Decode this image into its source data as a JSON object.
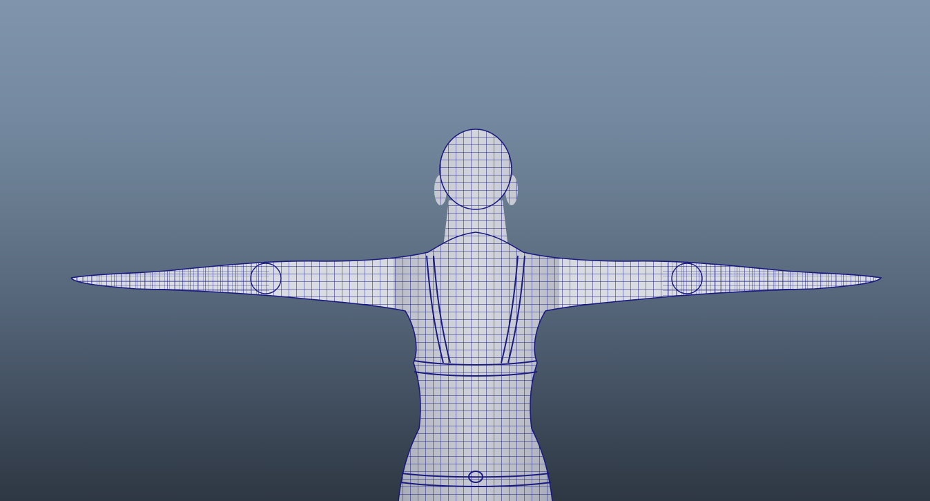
{
  "viewport": {
    "background_top": "#8095ac",
    "background_bottom": "#2e3743",
    "model_shade": "#c6c9d2",
    "wire_color": "#1a1a80"
  }
}
